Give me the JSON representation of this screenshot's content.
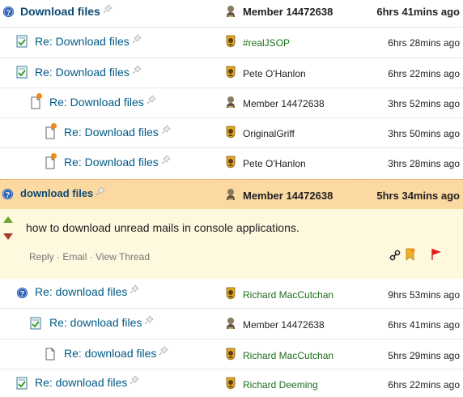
{
  "rows": [
    {
      "title": "Download files",
      "author": "Member 14472638",
      "time": "6hrs 41mins ago"
    },
    {
      "title": "Re: Download files",
      "author": "#realJSOP",
      "time": "6hrs 28mins ago"
    },
    {
      "title": "Re: Download files",
      "author": "Pete O'Hanlon",
      "time": "6hrs 22mins ago"
    },
    {
      "title": "Re: Download files",
      "author": "Member 14472638",
      "time": "3hrs 52mins ago"
    },
    {
      "title": "Re: Download files",
      "author": "OriginalGriff",
      "time": "3hrs 50mins ago"
    },
    {
      "title": "Re: Download files",
      "author": "Pete O'Hanlon",
      "time": "3hrs 28mins ago"
    },
    {
      "title": "download files",
      "author": "Member 14472638",
      "time": "5hrs 34mins ago"
    },
    {
      "title": "Re: download files",
      "author": "Richard MacCutchan",
      "time": "9hrs 53mins ago"
    },
    {
      "title": "Re: download files",
      "author": "Member 14472638",
      "time": "6hrs 41mins ago"
    },
    {
      "title": "Re: download files",
      "author": "Richard MacCutchan",
      "time": "5hrs 29mins ago"
    },
    {
      "title": "Re: download files",
      "author": "Richard Deeming",
      "time": "6hrs 22mins ago"
    }
  ],
  "selected_message": {
    "body": "how to download unread mails in console applications.",
    "actions": {
      "reply": "Reply",
      "email": "Email",
      "view_thread": "View Thread"
    },
    "separator": "·"
  },
  "icons": {
    "question": "question-icon",
    "answer": "answer-icon",
    "comment": "comment-icon",
    "pin": "pin-icon",
    "member_avatar": "member-avatar-icon",
    "mvp_badge": "mvp-badge-icon",
    "vote_up": "vote-up-icon",
    "vote_down": "vote-down-icon",
    "link": "link-icon",
    "bookmark": "bookmark-icon",
    "flag": "flag-icon"
  },
  "colors": {
    "link": "#005a86",
    "author_green": "#1b6e1b",
    "highlight": "#fcd9a1",
    "body_bg": "#fef8df",
    "new_dot": "#f08c1a"
  }
}
